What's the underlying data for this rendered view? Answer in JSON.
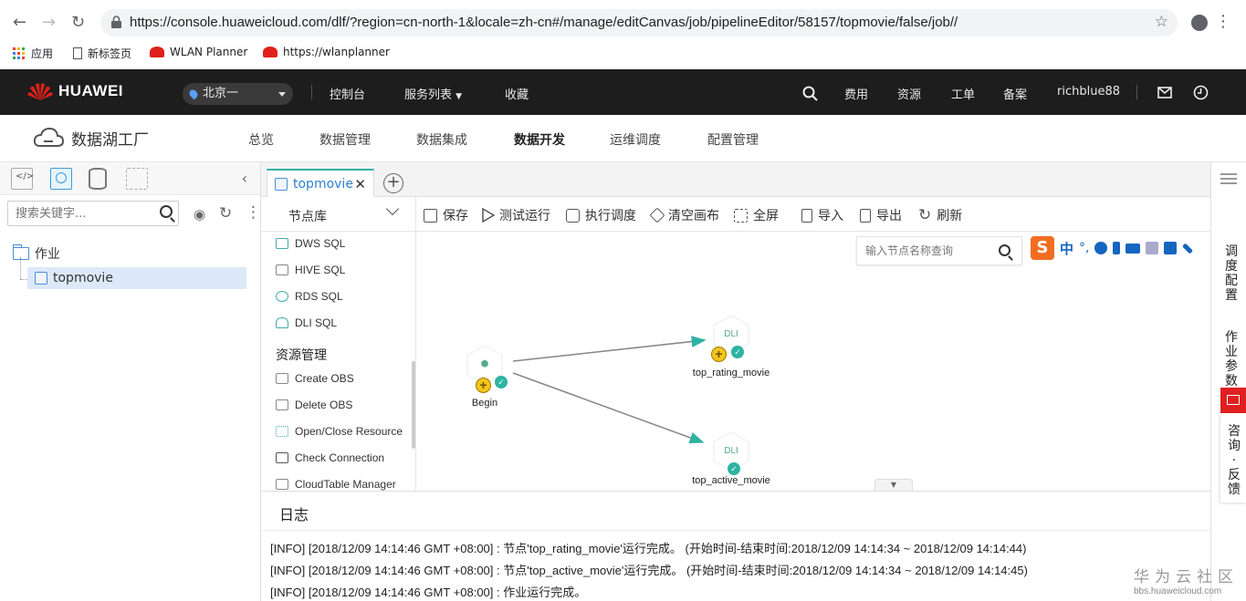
{
  "browser": {
    "url": "https://console.huaweicloud.com/dlf/?region=cn-north-1&locale=zh-cn#/manage/editCanvas/job/pipelineEditor/58157/topmovie/false/job//",
    "bookmarks": [
      "应用",
      "新标签页",
      "WLAN Planner",
      "https://wlanplanner"
    ]
  },
  "topbar": {
    "brand": "HUAWEI",
    "region": "北京一",
    "nav": [
      "控制台",
      "服务列表",
      "收藏"
    ],
    "right": [
      "费用",
      "资源",
      "工单",
      "备案",
      "richblue88"
    ]
  },
  "subbar": {
    "product": "数据湖工厂",
    "nav": [
      "总览",
      "数据管理",
      "数据集成",
      "数据开发",
      "运维调度",
      "配置管理"
    ],
    "active": "数据开发"
  },
  "left": {
    "search_placeholder": "搜索关键字...",
    "tree_root": "作业",
    "tree_child": "topmovie"
  },
  "editor": {
    "tab": "topmovie",
    "node_library_title": "节点库",
    "nodes_top": [
      "DWS SQL",
      "HIVE SQL",
      "RDS SQL",
      "DLI SQL"
    ],
    "group_resource": "资源管理",
    "nodes_resource": [
      "Create OBS",
      "Delete OBS",
      "Open/Close Resource",
      "Check Connection",
      "CloudTable Manager"
    ],
    "toolbar": [
      "保存",
      "测试运行",
      "执行调度",
      "清空画布",
      "全屏",
      "导入",
      "导出",
      "刷新"
    ],
    "node_search_placeholder": "输入节点名称查询",
    "ime": [
      "S",
      "中"
    ]
  },
  "canvas": {
    "nodes": [
      {
        "name": "Begin",
        "icon": "cube-icon"
      },
      {
        "name": "top_rating_movie",
        "icon": "dli-cloud-icon",
        "badge": "DLI"
      },
      {
        "name": "top_active_movie",
        "icon": "dli-cloud-icon",
        "badge": "DLI"
      }
    ],
    "edges": [
      [
        "Begin",
        "top_rating_movie"
      ],
      [
        "Begin",
        "top_active_movie"
      ]
    ]
  },
  "log": {
    "title": "日志",
    "lines": [
      "[INFO] [2018/12/09 14:14:46 GMT +08:00] : 节点'top_rating_movie'运行完成。 (开始时间-结束时间:2018/12/09 14:14:34 ~ 2018/12/09 14:14:44)",
      "[INFO] [2018/12/09 14:14:46 GMT +08:00] : 节点'top_active_movie'运行完成。 (开始时间-结束时间:2018/12/09 14:14:34 ~ 2018/12/09 14:14:45)",
      "[INFO] [2018/12/09 14:14:46 GMT +08:00] : 作业运行完成。"
    ]
  },
  "right": {
    "schedule": "调度配置",
    "params": "作业参数",
    "feedback": "咨询·反馈"
  },
  "watermark": {
    "title": "华为云社区",
    "site": "bbs.huaweicloud.com"
  },
  "colors": {
    "accent": "#2eb3a2",
    "link": "#2a7fd4",
    "topbar": "#1d1d1d",
    "feedback": "#e02020"
  }
}
